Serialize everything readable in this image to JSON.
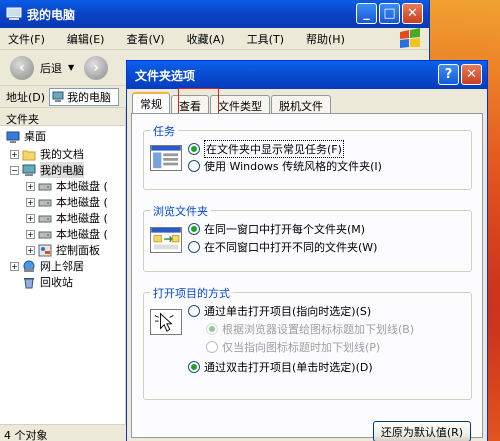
{
  "explorer": {
    "title": "我的电脑",
    "menu": [
      "文件(F)",
      "编辑(E)",
      "查看(V)",
      "收藏(A)",
      "工具(T)",
      "帮助(H)"
    ],
    "back_label": "后退",
    "address_label": "地址(D)",
    "address_value": "我的电脑",
    "pane_title": "文件夹",
    "tree": {
      "desktop": "桌面",
      "my_documents": "我的文档",
      "my_computer": "我的电脑",
      "disk1": "本地磁盘 (",
      "disk2": "本地磁盘 (",
      "disk3": "本地磁盘 (",
      "disk4": "本地磁盘 (",
      "control_panel": "控制面板",
      "network": "网上邻居",
      "recycle": "回收站"
    },
    "status": "4 个对象"
  },
  "dialog": {
    "title": "文件夹选项",
    "tabs": [
      "常规",
      "查看",
      "文件类型",
      "脱机文件"
    ],
    "tasks": {
      "label": "任务",
      "opt1": "在文件夹中显示常见任务(F)",
      "opt2": "使用 Windows 传统风格的文件夹(I)"
    },
    "browse": {
      "label": "浏览文件夹",
      "opt1": "在同一窗口中打开每个文件夹(M)",
      "opt2": "在不同窗口中打开不同的文件夹(W)"
    },
    "click": {
      "label": "打开项目的方式",
      "opt1": "通过单击打开项目(指向时选定)(S)",
      "sub1": "根据浏览器设置给图标标题加下划线(B)",
      "sub2": "仅当指向图标标题时加下划线(P)",
      "opt2": "通过双击打开项目(单击时选定)(D)"
    },
    "restore_button": "还原为默认值(R)"
  },
  "colors": {
    "titlebar": "#0a5ce6",
    "tab_highlight": "#e02020",
    "group_label": "#0046d5"
  }
}
